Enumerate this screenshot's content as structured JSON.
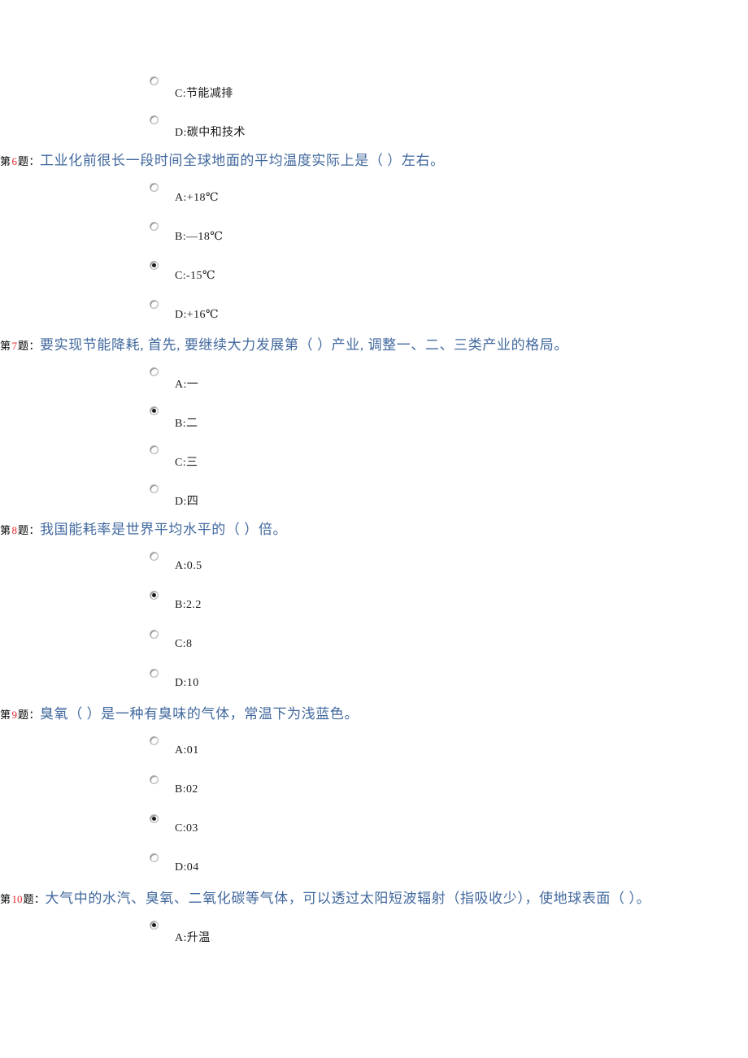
{
  "theme": {
    "page_background": "#ffffff",
    "question_text_color": "#41689e",
    "question_number_color": "#e8262b",
    "prefix_color": "#000000",
    "option_text_color": "#1a1a1a",
    "radio_border_color": "#b9b9b9",
    "radio_dot_color": "#1a1a1a"
  },
  "labels": {
    "prefix": "第",
    "suffix": "题："
  },
  "partial_question_top": {
    "name": "question-5-partial",
    "options": [
      {
        "key": "C",
        "label": "C:节能减排",
        "checked": false
      },
      {
        "key": "D",
        "label": "D:碳中和技术",
        "checked": false
      }
    ]
  },
  "questions": [
    {
      "number": "6",
      "text": "工业化前很长一段时间全球地面的平均温度实际上是（ ）左右。",
      "options": [
        {
          "key": "A",
          "label": "A:+18℃",
          "checked": false
        },
        {
          "key": "B",
          "label": "B:—18℃",
          "checked": false
        },
        {
          "key": "C",
          "label": "C:-15℃",
          "checked": true
        },
        {
          "key": "D",
          "label": "D:+16℃",
          "checked": false
        }
      ]
    },
    {
      "number": "7",
      "text": "要实现节能降耗, 首先, 要继续大力发展第（ ）产业, 调整一、二、三类产业的格局。",
      "options": [
        {
          "key": "A",
          "label": "A:一",
          "checked": false
        },
        {
          "key": "B",
          "label": "B:二",
          "checked": true
        },
        {
          "key": "C",
          "label": "C:三",
          "checked": false
        },
        {
          "key": "D",
          "label": "D:四",
          "checked": false
        }
      ]
    },
    {
      "number": "8",
      "text": "我国能耗率是世界平均水平的（ ）倍。",
      "options": [
        {
          "key": "A",
          "label": "A:0.5",
          "checked": false
        },
        {
          "key": "B",
          "label": "B:2.2",
          "checked": true
        },
        {
          "key": "C",
          "label": "C:8",
          "checked": false
        },
        {
          "key": "D",
          "label": "D:10",
          "checked": false
        }
      ]
    },
    {
      "number": "9",
      "text": "臭氧（ ）是一种有臭味的气体，常温下为浅蓝色。",
      "options": [
        {
          "key": "A",
          "label": "A:01",
          "checked": false
        },
        {
          "key": "B",
          "label": "B:02",
          "checked": false
        },
        {
          "key": "C",
          "label": "C:03",
          "checked": true
        },
        {
          "key": "D",
          "label": "D:04",
          "checked": false
        }
      ]
    },
    {
      "number": "10",
      "text": "大气中的水汽、臭氧、二氧化碳等气体，可以透过太阳短波辐射（指吸收少），使地球表面（ ）。",
      "options": [
        {
          "key": "A",
          "label": "A:升温",
          "checked": true
        }
      ]
    }
  ]
}
